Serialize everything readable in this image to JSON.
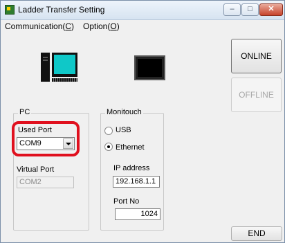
{
  "window": {
    "title": "Ladder Transfer Setting"
  },
  "menu": {
    "items": [
      {
        "label": "Communication(",
        "accel": "C",
        "end": ")"
      },
      {
        "label": "Option(",
        "accel": "O",
        "end": ")"
      }
    ]
  },
  "buttons": {
    "online": "ONLINE",
    "offline": "OFFLINE",
    "end": "END"
  },
  "pc_group": {
    "title": "PC",
    "used_port_label": "Used Port",
    "used_port_value": "COM9",
    "virtual_port_label": "Virtual Port",
    "virtual_port_value": "COM2"
  },
  "monitouch_group": {
    "title": "Monitouch",
    "usb_label": "USB",
    "ethernet_label": "Ethernet",
    "selected": "Ethernet",
    "ip_label": "IP address",
    "ip_value": "192.168.1.1",
    "port_label": "Port No",
    "port_value": "1024"
  },
  "colors": {
    "highlight": "#e0101e",
    "pc_screen": "#0fc8c8"
  },
  "icons": [
    "app-icon",
    "pc-icon",
    "monitouch-panel-icon",
    "minimize-icon",
    "maximize-icon",
    "close-icon",
    "chevron-down-icon"
  ]
}
